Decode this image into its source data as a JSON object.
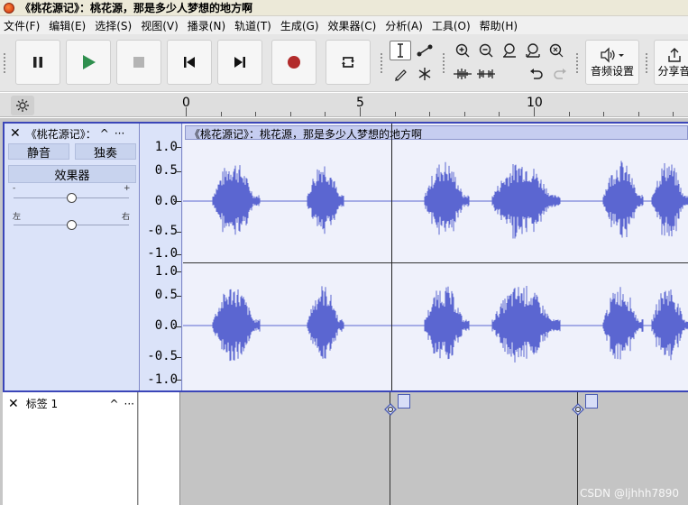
{
  "window": {
    "title": "《桃花源记》：桃花源，那是多少人梦想的地方啊"
  },
  "menu": [
    "文件(F)",
    "编辑(E)",
    "选择(S)",
    "视图(V)",
    "播录(N)",
    "轨道(T)",
    "生成(G)",
    "效果器(C)",
    "分析(A)",
    "工具(O)",
    "帮助(H)"
  ],
  "toolbar": {
    "transport_icons": [
      "pause-icon",
      "play-icon",
      "stop-icon",
      "skip-to-start-icon",
      "skip-to-end-icon",
      "record-icon",
      "loop-icon"
    ],
    "tool_icons": [
      "selection-tool-icon",
      "envelope-tool-icon",
      "draw-tool-icon",
      "multi-tool-icon"
    ],
    "zoom_icons": [
      "zoom-in-icon",
      "zoom-out-icon",
      "fit-selection-icon",
      "fit-project-icon",
      "zoom-toggle-icon"
    ],
    "edit_icons": [
      "trim-audio-icon",
      "silence-audio-icon",
      "undo-icon",
      "redo-icon"
    ],
    "audio_setup_label": "音频设置",
    "share_label": "分享音"
  },
  "ruler": {
    "labels": [
      "0",
      "5",
      "10"
    ]
  },
  "audio_track": {
    "name": "《桃花源记》：",
    "mute_label": "静音",
    "solo_label": "独奏",
    "effects_label": "效果器",
    "gain_minus": "-",
    "gain_plus": "+",
    "pan_left": "左",
    "pan_right": "右",
    "gain_level": 0.5,
    "pan_level": 0.5,
    "clip_title": "《桃花源记》：桃花源，那是多少人梦想的地方啊",
    "vruler_labels": [
      "1.0",
      "0.5",
      "0.0",
      "-0.5",
      "-1.0"
    ],
    "wave_color": "#5b66d1"
  },
  "label_track": {
    "name": "标签 1"
  },
  "watermark": "CSDN @ljhhh7890",
  "colors": {
    "track_border": "#3b46b8",
    "waveform": "#5b66d1",
    "record": "#b22b2b",
    "play": "#2f8f4e"
  }
}
